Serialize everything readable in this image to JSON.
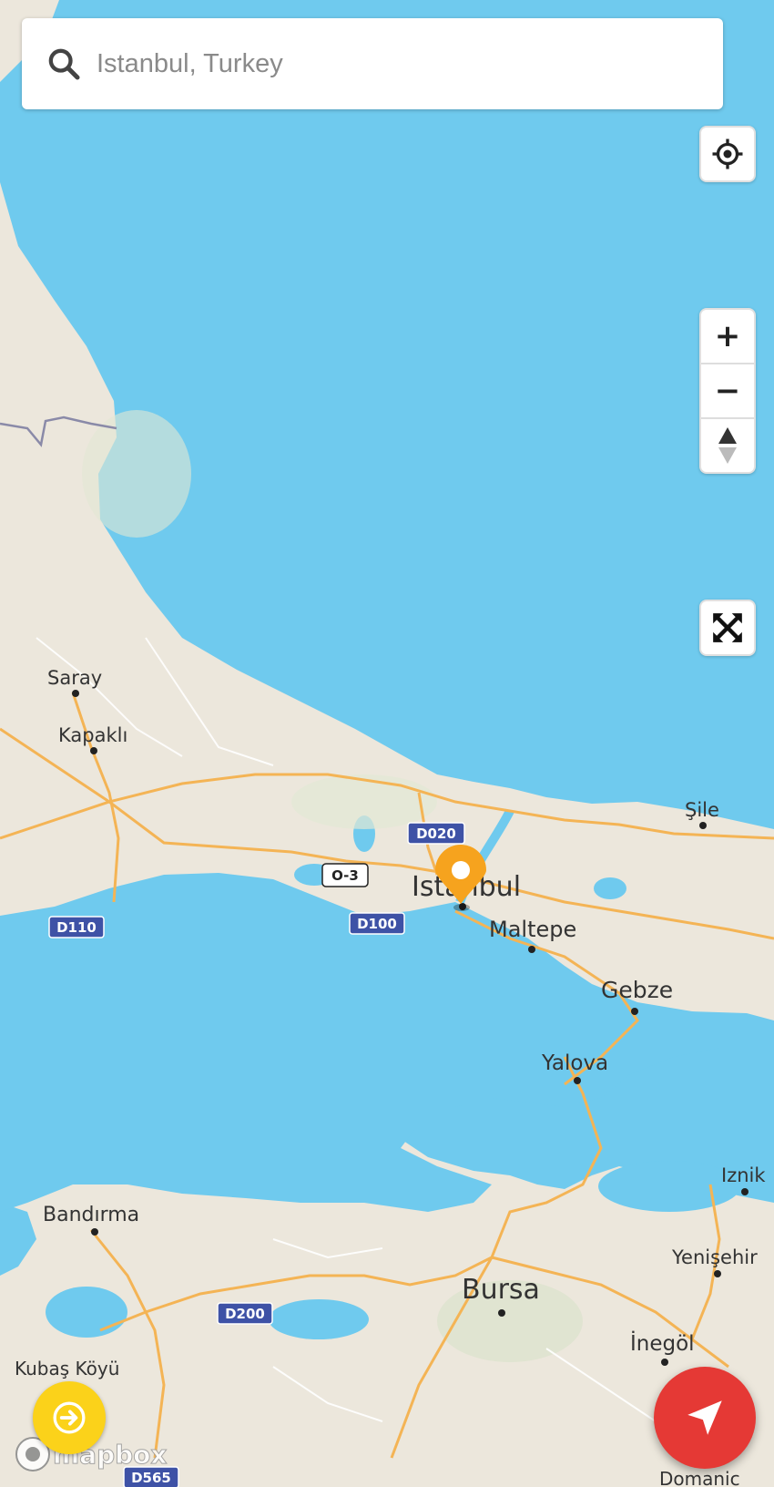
{
  "search": {
    "placeholder": "Istanbul, Turkey"
  },
  "controls": {
    "locate": "locate-me",
    "zoom_in": "+",
    "zoom_out": "−",
    "compass": "compass",
    "fullscreen": "fullscreen"
  },
  "map": {
    "places": [
      {
        "name": "Saray",
        "size": "small"
      },
      {
        "name": "Kapaklı",
        "size": "small"
      },
      {
        "name": "Şile",
        "size": "small"
      },
      {
        "name": "Istanbul",
        "size": "large"
      },
      {
        "name": "Maltepe",
        "size": "medium"
      },
      {
        "name": "Gebze",
        "size": "medium"
      },
      {
        "name": "Yalova",
        "size": "medium"
      },
      {
        "name": "Iznik",
        "size": "small"
      },
      {
        "name": "Bandırma",
        "size": "medium"
      },
      {
        "name": "Yenişehir",
        "size": "small"
      },
      {
        "name": "Bursa",
        "size": "large"
      },
      {
        "name": "İnegöl",
        "size": "medium"
      },
      {
        "name": "Kubaş Köyü",
        "size": "small"
      },
      {
        "name": "Domanic",
        "size": "small"
      }
    ],
    "road_shields": [
      {
        "ref": "D020",
        "style": "blue"
      },
      {
        "ref": "O-3",
        "style": "white"
      },
      {
        "ref": "D100",
        "style": "blue"
      },
      {
        "ref": "D110",
        "style": "blue"
      },
      {
        "ref": "D200",
        "style": "blue"
      },
      {
        "ref": "D565",
        "style": "blue"
      }
    ],
    "attribution": "mapbox",
    "colors": {
      "water": "#6fcaee",
      "land": "#ece7dc",
      "road": "#f4b455",
      "marker": "#f6a31e"
    }
  },
  "buttons": {
    "go_icon": "arrow-right-icon",
    "navigate_icon": "navigation-arrow-icon"
  }
}
